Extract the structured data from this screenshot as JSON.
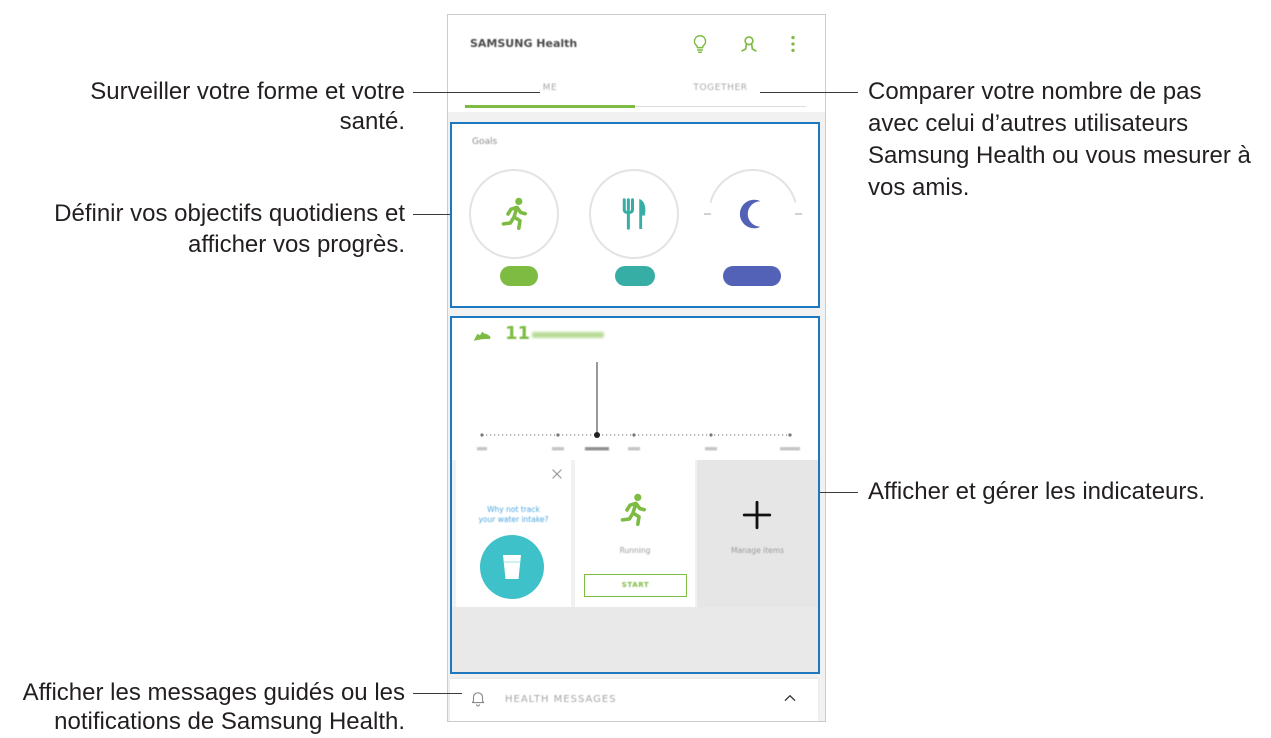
{
  "callouts": {
    "track": {
      "lines": [
        "Surveiller votre forme et votre",
        "santé."
      ]
    },
    "goals": {
      "lines": [
        "Définir vos objectifs quotidiens et",
        "afficher vos progrès."
      ]
    },
    "compare": {
      "lines": [
        "Comparer votre nombre de pas",
        "avec celui d’autres utilisateurs",
        "Samsung Health ou vous mesurer à",
        "vos amis."
      ]
    },
    "trackers": {
      "lines": [
        "Afficher et gérer les indicateurs."
      ]
    },
    "messages": {
      "lines": [
        "Afficher les messages guidés ou les",
        "notifications de Samsung Health."
      ]
    }
  },
  "app": {
    "header": {
      "title": "SAMSUNG Health"
    },
    "tabs": [
      {
        "label": "ME",
        "active": true
      },
      {
        "label": "TOGETHER",
        "active": false
      }
    ],
    "goals": {
      "label": "Goals"
    },
    "steps": {
      "count_prefix": "11"
    },
    "cards": {
      "water": {
        "lines": [
          "Why not track",
          "your water intake?"
        ]
      },
      "running": {
        "label": "Running",
        "button": "START"
      },
      "manage": {
        "label": "Manage items"
      }
    },
    "messages_bar": {
      "label": "HEALTH MESSAGES"
    }
  },
  "icons": {
    "header": [
      "lightbulb-icon",
      "together-icon",
      "more-options-icon"
    ],
    "goals": [
      "running-icon",
      "fork-knife-icon",
      "moon-icon"
    ],
    "steps": "shoe-icon",
    "water_card": [
      "close-icon",
      "cup-icon"
    ],
    "running_card": "running-icon",
    "manage_card": "plus-icon",
    "messages_bar": [
      "bell-icon",
      "chevron-up-icon"
    ]
  },
  "colors": {
    "green": "#7dbb42",
    "teal": "#36aea6",
    "purple": "#5362b6",
    "water": "#3fc1c9",
    "highlight_box": "#1f78be",
    "link_blue": "#4aa5df"
  }
}
